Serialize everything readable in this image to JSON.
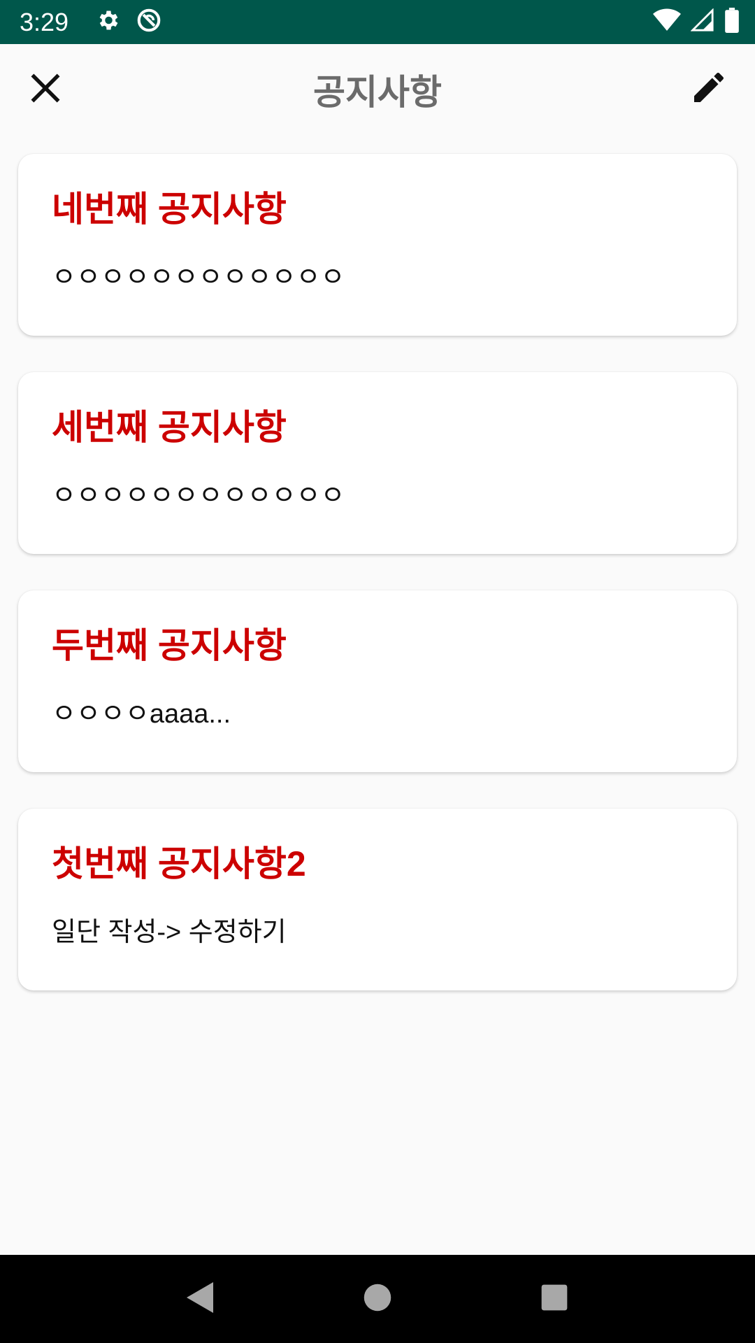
{
  "status_bar": {
    "time": "3:29",
    "icons": [
      "gear-icon",
      "sync-disabled-icon",
      "wifi-icon",
      "signal-icon",
      "battery-icon"
    ]
  },
  "app_bar": {
    "title": "공지사항",
    "close_icon": "close-icon",
    "edit_icon": "edit-icon"
  },
  "notices": [
    {
      "title": "네번째 공지사항",
      "body": "ㅇㅇㅇㅇㅇㅇㅇㅇㅇㅇㅇㅇ"
    },
    {
      "title": "세번째 공지사항",
      "body": "ㅇㅇㅇㅇㅇㅇㅇㅇㅇㅇㅇㅇ"
    },
    {
      "title": "두번째 공지사항",
      "body": "ㅇㅇㅇㅇaaaa..."
    },
    {
      "title": "첫번째 공지사항2",
      "body": "일단 작성-> 수정하기"
    }
  ],
  "colors": {
    "status_bar": "#00574b",
    "title_text": "#cc0000",
    "app_title": "#6b6b6b",
    "background": "#fafafa"
  },
  "nav_bar": {
    "icons": [
      "back-icon",
      "home-icon",
      "recents-icon"
    ]
  }
}
